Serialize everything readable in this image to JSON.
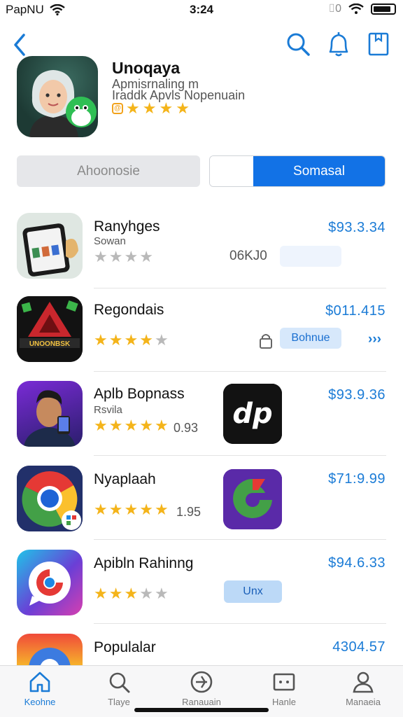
{
  "status": {
    "carrier": "PapNU",
    "time": "3:24",
    "right_text": "⌷0"
  },
  "header": {
    "app_name": "Unoqaya",
    "sub_line1": "Apmisrnaling m",
    "sub_line2": "Iraddk Apvls Nopenuain",
    "rating_stars": 4
  },
  "segments": {
    "left": "Ahoonosie",
    "right": "Somasal"
  },
  "list": [
    {
      "title": "Ranyhges",
      "subtitle": "Sowan",
      "stars": 0,
      "count": "06KJ0",
      "button": "",
      "price": "$93.3.34",
      "arrow": ""
    },
    {
      "title": "Regondais",
      "subtitle": "",
      "stars": 3.5,
      "count": "",
      "button": "Bohnue",
      "price": "$011.415",
      "arrow": "›››",
      "icon_text": "UNOONBSK"
    },
    {
      "title": "Aplb Bopnass",
      "subtitle": "Rsvila",
      "stars": 4.5,
      "rating_value": "0.93",
      "price": "$93.9.36"
    },
    {
      "title": "Nyaplaah",
      "subtitle": "",
      "stars": 4,
      "rating_value": "1.95",
      "price": "$71:9.99"
    },
    {
      "title": "Apibln Rahinng",
      "subtitle": "",
      "stars": 3,
      "button": "Unx",
      "price": "$94.6.33"
    },
    {
      "title": "Populalar",
      "subtitle": "",
      "price": "4304.57"
    }
  ],
  "tabs": [
    {
      "label": "Keohne",
      "icon": "home-icon",
      "active": true
    },
    {
      "label": "Tlaye",
      "icon": "search-icon",
      "active": false
    },
    {
      "label": "Ranauain",
      "icon": "compass-icon",
      "active": false
    },
    {
      "label": "Hanle",
      "icon": "apps-icon",
      "active": false
    },
    {
      "label": "Manaeia",
      "icon": "person-icon",
      "active": false
    }
  ],
  "colors": {
    "accent": "#1272e6",
    "price": "#1a7bd6",
    "star": "#f4b41a"
  }
}
